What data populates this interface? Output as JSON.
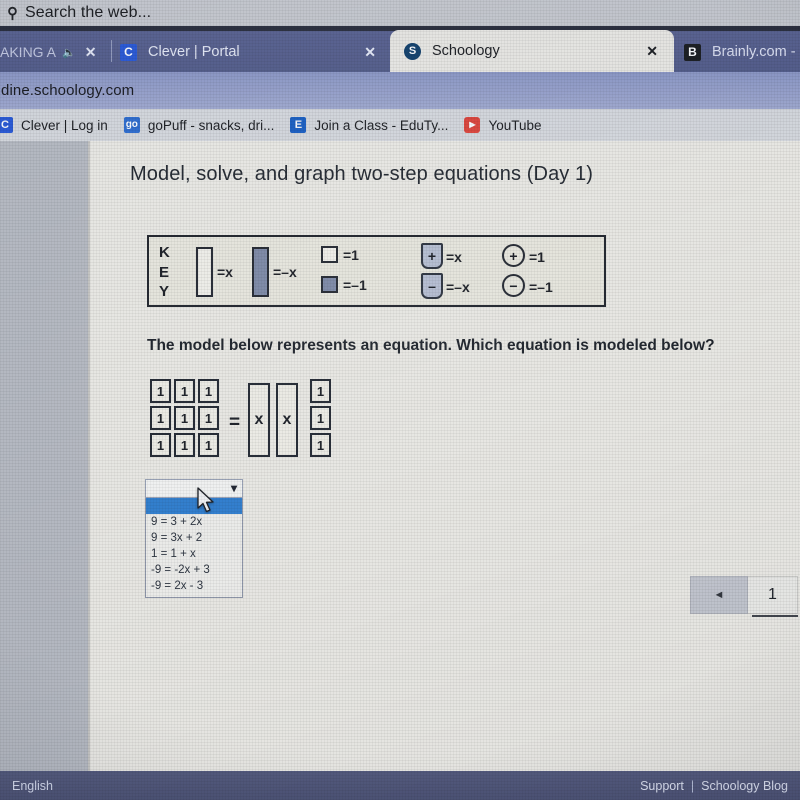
{
  "os_bar": {
    "search_icon": "search-icon",
    "search_text": "Search the web..."
  },
  "browser": {
    "tabs": [
      {
        "label": "AKING A",
        "favicon": "",
        "close_label": "✕",
        "mute_icon": "🔊",
        "active": false
      },
      {
        "label": "Clever | Portal",
        "favicon": "C",
        "close_label": "✕",
        "active": false
      },
      {
        "label": "Schoology",
        "favicon": "S",
        "close_label": "✕",
        "active": true
      },
      {
        "label": "Brainly.com - F",
        "favicon": "B",
        "close_label": "",
        "active": false
      }
    ],
    "address": "dine.schoology.com",
    "bookmarks": [
      {
        "label": "Clever | Log in",
        "favicon": "C"
      },
      {
        "label": "goPuff - snacks, dri...",
        "favicon": "go"
      },
      {
        "label": "Join a Class - EduTy...",
        "favicon": "E"
      },
      {
        "label": "YouTube",
        "favicon": "▶"
      }
    ]
  },
  "page": {
    "title": "Model, solve, and graph two-step equations (Day 1)",
    "prompt": "The model below represents an equation. Which equation is modeled below?",
    "key": {
      "letters": "K\nE\nY",
      "long_bar_white_eq": "=x",
      "long_bar_shaded_eq": "=–x",
      "square_white_eq": "=1",
      "square_shaded_eq": "=–1",
      "cup_plus_symbol": "+",
      "cup_plus_eq": "=x",
      "cup_minus_symbol": "–",
      "cup_minus_eq": "=–x",
      "chip_plus_symbol": "+",
      "chip_plus_eq": "=1",
      "chip_minus_symbol": "−",
      "chip_minus_eq": "=–1"
    },
    "model": {
      "left_unit_label": "1",
      "left_unit_count": 9,
      "equals": "=",
      "x_bar_label": "x",
      "x_bar_count": 2,
      "right_unit_label": "1",
      "right_unit_count": 3
    },
    "dropdown": {
      "selected_value": "",
      "chevron_icon": "chevron-down-icon",
      "options": [
        "",
        "9 = 3 + 2x",
        "9 = 3x + 2",
        "1 = 1 + x",
        "-9 = -2x + 3",
        "-9 = 2x - 3"
      ]
    },
    "pagination": {
      "prev_label": "◄",
      "current_page": "1"
    }
  },
  "footer": {
    "language": "English",
    "support_label": "Support",
    "separator": "|",
    "blog_label": "Schoology Blog"
  }
}
